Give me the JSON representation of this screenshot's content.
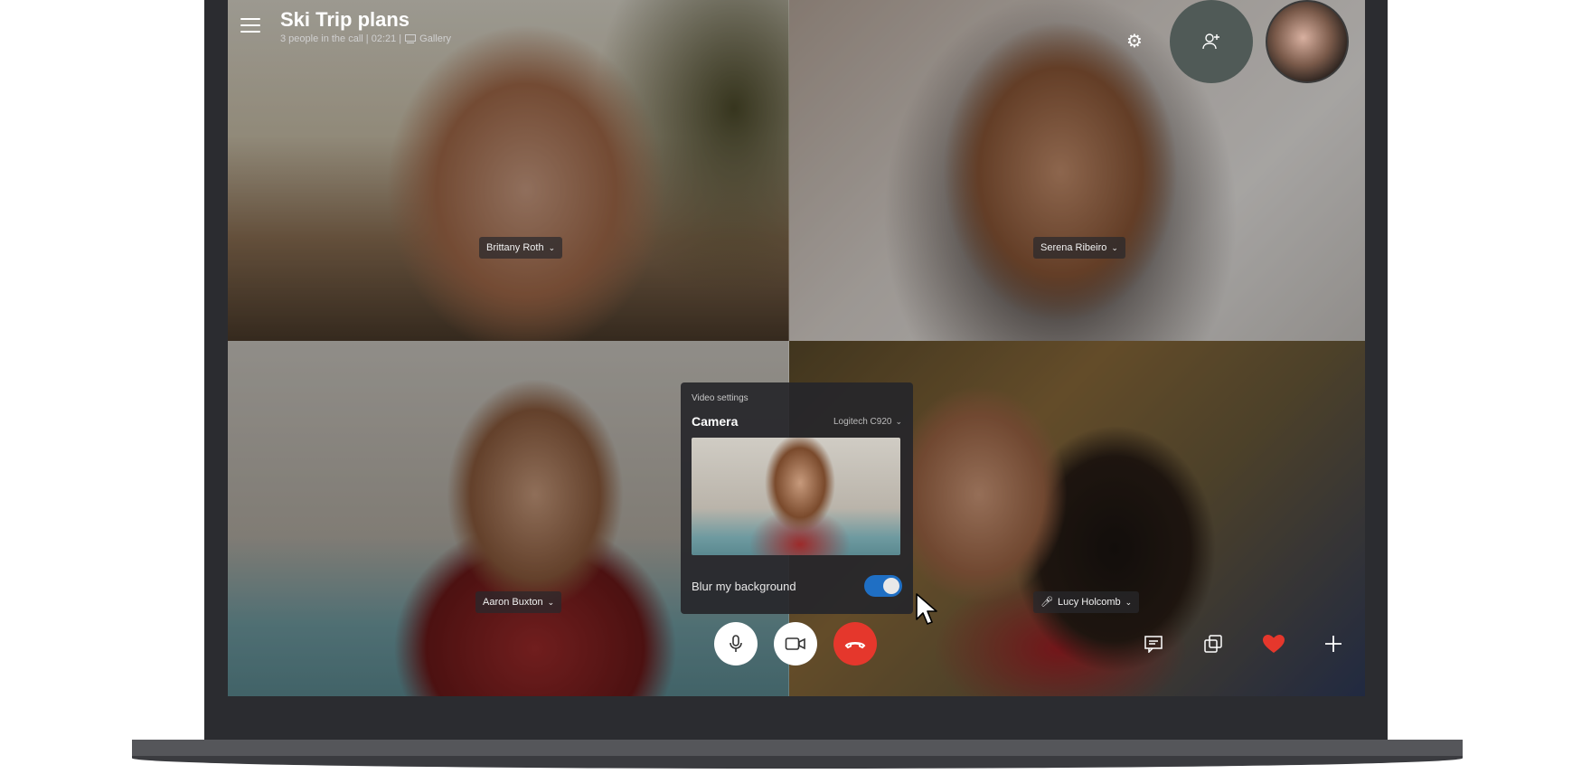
{
  "call": {
    "title": "Ski Trip plans",
    "participants_text": "3 people in the call | 02:21 |",
    "view_mode": "Gallery"
  },
  "participants": [
    {
      "name": "Brittany Roth"
    },
    {
      "name": "Serena Ribeiro"
    },
    {
      "name": "Aaron Buxton"
    },
    {
      "name": "Lucy Holcomb"
    }
  ],
  "video_settings": {
    "header": "Video settings",
    "camera_label": "Camera",
    "camera_device": "Logitech C920",
    "blur_label": "Blur my background",
    "blur_enabled": true
  },
  "colors": {
    "end_call": "#e5372c",
    "toggle_on": "#1f6fc4",
    "react_heart": "#e5372c"
  },
  "icons": {
    "menu": "hamburger-icon",
    "settings": "gear-icon",
    "add_person": "add-person-icon",
    "mic": "microphone-icon",
    "video": "video-camera-icon",
    "end_call": "hang-up-icon",
    "chat": "chat-icon",
    "share": "share-screen-icon",
    "react": "heart-icon",
    "more": "plus-icon"
  }
}
